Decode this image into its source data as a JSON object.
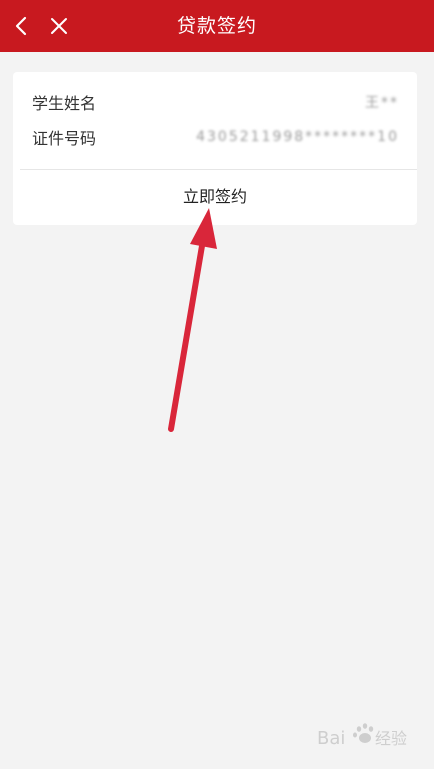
{
  "header": {
    "title": "贷款签约"
  },
  "card": {
    "rows": [
      {
        "label": "学生姓名",
        "value": "王**"
      },
      {
        "label": "证件号码",
        "value": "4305211998********10"
      }
    ],
    "sign_label": "立即签约"
  },
  "watermark": {
    "text": "Bai 经验"
  },
  "colors": {
    "header_bg": "#c8191f",
    "page_bg": "#f3f3f3",
    "arrow": "#d9263a"
  }
}
